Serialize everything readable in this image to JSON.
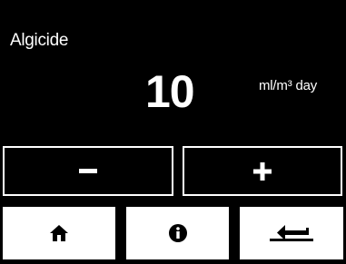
{
  "screen": {
    "title": "Algicide",
    "value": "10",
    "unit": "ml/m³ day"
  },
  "stepper": {
    "minus_icon": "minus-icon",
    "plus_icon": "plus-icon"
  },
  "nav": {
    "home_icon": "home-icon",
    "info_icon": "info-icon",
    "back_icon": "return-arrow-icon"
  },
  "colors": {
    "background": "#000000",
    "foreground": "#ffffff"
  }
}
